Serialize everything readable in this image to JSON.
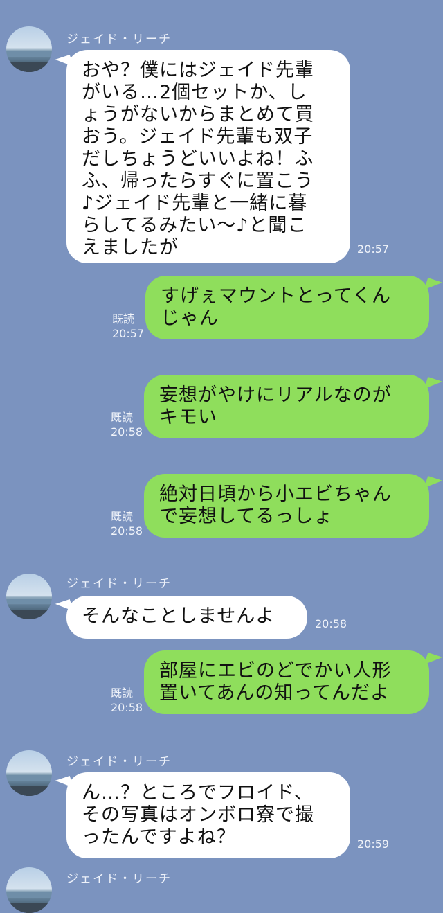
{
  "contact": {
    "name": "ジェイド・リーチ"
  },
  "read_label": "既読",
  "messages": [
    {
      "dir": "in",
      "show_sender": true,
      "text": "おや？僕にはジェイド先輩\nがいる…2個セットか、し\nょうがないからまとめて買\nおう。ジェイド先輩も双子\nだしちょうどいいよね！ふ\nふ、帰ったらすぐに置こう\n♪ジェイド先輩と一緒に暮\nらしてるみたい〜♪と聞こ\nえましたが",
      "time": "20:57"
    },
    {
      "dir": "out",
      "text": "すげぇマウントとってくん\nじゃん",
      "time": "20:57"
    },
    {
      "dir": "out",
      "text": "妄想がやけにリアルなのが\nキモい",
      "time": "20:58"
    },
    {
      "dir": "out",
      "text": "絶対日頃から小エビちゃん\nで妄想してるっしょ",
      "time": "20:58"
    },
    {
      "dir": "in",
      "show_sender": true,
      "text": "そんなことしませんよ",
      "time": "20:58"
    },
    {
      "dir": "out",
      "text": "部屋にエビのどでかい人形\n置いてあんの知ってんだよ",
      "time": "20:58"
    },
    {
      "dir": "in",
      "show_sender": true,
      "text": "ん…？ところでフロイド、\nその写真はオンボロ寮で撮\nったんですよね？",
      "time": "20:59"
    }
  ],
  "colors": {
    "background": "#7b93bf",
    "incoming_bubble": "#ffffff",
    "outgoing_bubble": "#8fde5c"
  },
  "icons": {
    "avatar": "avatar-beach-photo"
  }
}
